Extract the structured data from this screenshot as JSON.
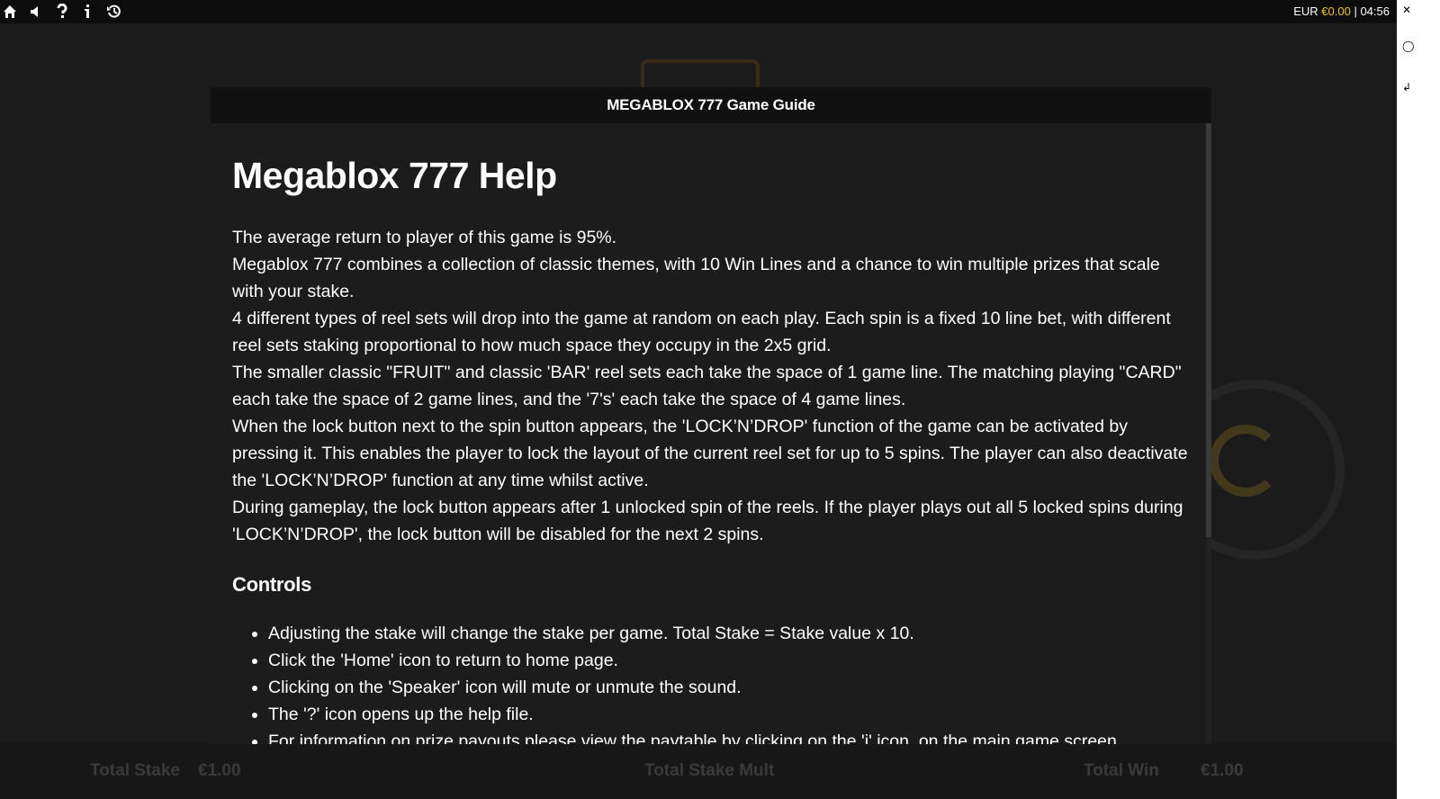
{
  "topbar": {
    "icons": [
      "home-icon",
      "speaker-icon",
      "help-icon",
      "info-icon",
      "history-icon"
    ],
    "currency": "EUR",
    "balance": "€0.00",
    "separator": "|",
    "clock": "04:56"
  },
  "modal": {
    "header_title": "MEGABLOX 777 Game Guide",
    "title": "Megablox 777 Help",
    "paragraphs": [
      "The average return to player of this game is 95%.",
      "Megablox 777 combines a collection of classic themes, with 10 Win Lines and a chance to win multiple prizes that scale with your stake.",
      "4 different types of reel sets will drop into the game at random on each play. Each spin is a fixed 10 line bet, with different reel sets staking proportional to how much space they occupy in the 2x5 grid.",
      "The smaller classic \"FRUIT\" and classic 'BAR' reel sets each take the space of 1 game line. The matching playing \"CARD\" each take the space of 2 game lines, and the '7's' each take the space of 4 game lines.",
      "When the lock button next to the spin button appears, the 'LOCK’N’DROP' function of the game can be activated by pressing it. This enables the player to lock the layout of the current reel set for up to 5 spins. The player can also deactivate the 'LOCK’N’DROP' function at any time whilst active.",
      "During gameplay, the lock button appears after 1 unlocked spin of the reels. If the player plays out all 5 locked spins during 'LOCK’N’DROP', the lock button will be disabled for the next 2 spins."
    ],
    "controls_heading": "Controls",
    "controls": [
      "Adjusting the stake will change the stake per game. Total Stake = Stake value x 10.",
      "Click the 'Home' icon to return to home page.",
      "Clicking on the 'Speaker' icon will mute or unmute the sound.",
      "The '?' icon opens up the help file.",
      "For information on prize payouts please view the paytable by clicking on the 'i' icon, on the main game screen."
    ]
  },
  "background": {
    "total_stake_label": "Total Stake",
    "total_stake_value": "€1.00",
    "middle_label": "Total Stake Mult",
    "win_label": "Total Win",
    "win_value": "€1.00"
  },
  "colors": {
    "accent": "#f3c318",
    "modal_bg": "#1c1c1c",
    "header_bg": "#111111"
  }
}
